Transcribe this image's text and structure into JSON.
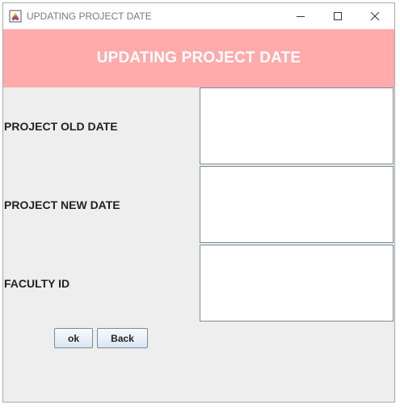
{
  "window": {
    "title": "UPDATING PROJECT DATE"
  },
  "header": {
    "title": "UPDATING PROJECT DATE",
    "background": "#ffabab"
  },
  "form": {
    "fields": [
      {
        "label": "PROJECT OLD DATE",
        "value": ""
      },
      {
        "label": "PROJECT NEW DATE",
        "value": ""
      },
      {
        "label": "FACULTY ID",
        "value": ""
      }
    ]
  },
  "buttons": {
    "ok_label": "ok",
    "back_label": "Back"
  },
  "icons": {
    "app": "java-app-icon",
    "minimize": "minimize-icon",
    "maximize": "maximize-icon",
    "close": "close-icon"
  }
}
